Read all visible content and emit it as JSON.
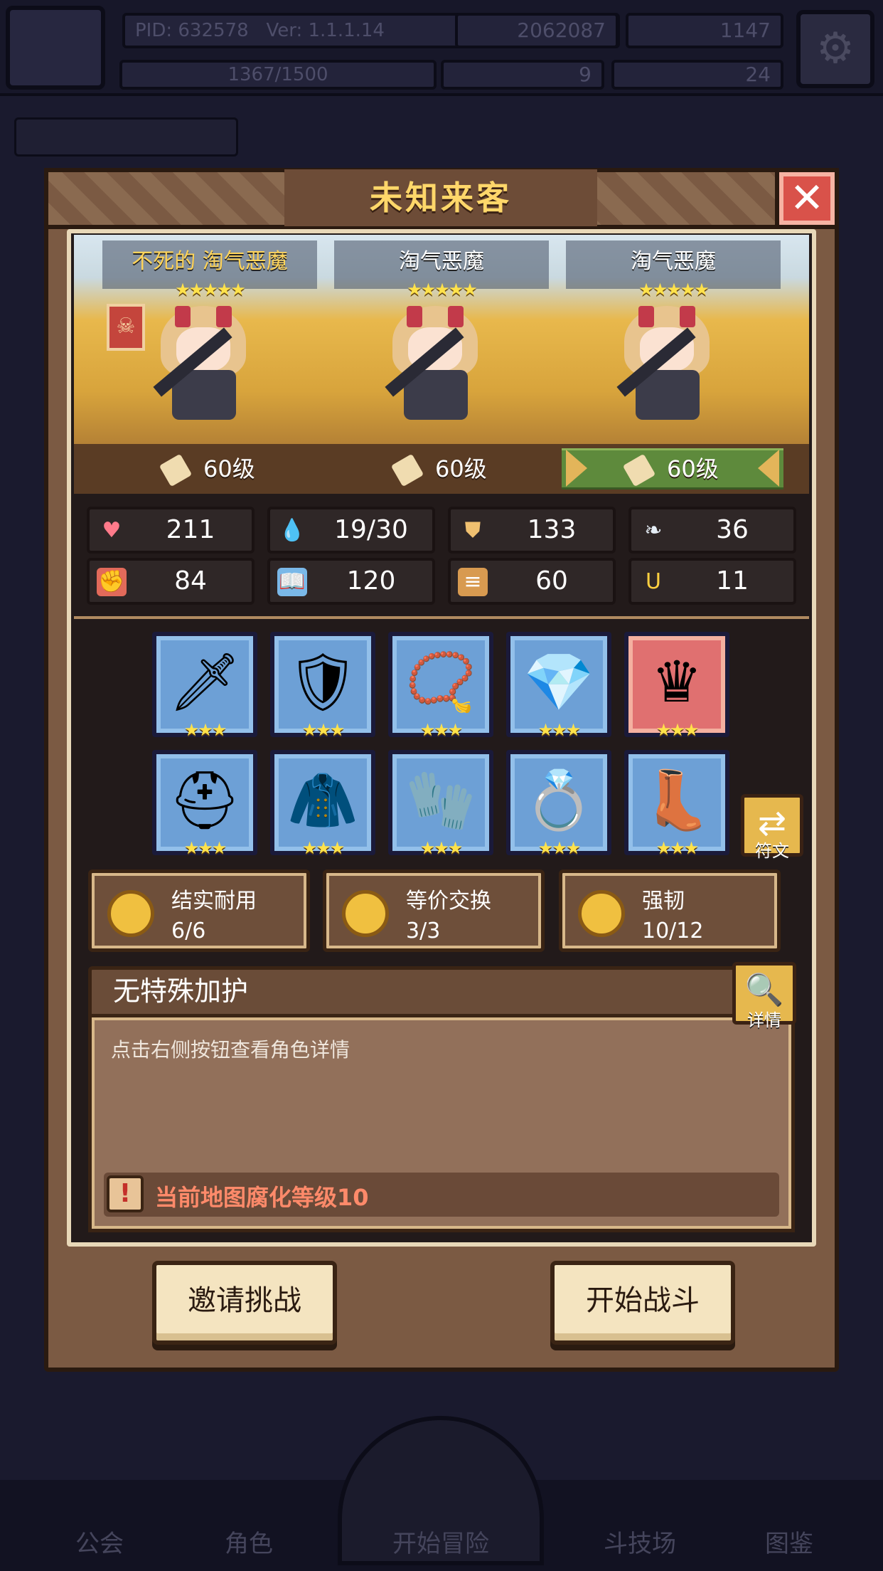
{
  "background": {
    "pid": "PID: 632578",
    "version": "Ver: 1.1.1.14",
    "currency_1": "2062087",
    "currency_2": "1147",
    "exp": "1367/1500",
    "currency_3": "9",
    "currency_4": "24",
    "nav": [
      "公会",
      "角色",
      "开始冒险",
      "斗技场",
      "图鉴"
    ]
  },
  "dialog": {
    "title": "未知来客",
    "close_icon": "close-icon",
    "enemies": [
      {
        "name": "不死的 淘气恶魔",
        "stars": "★★★★★",
        "level": "60级",
        "name_color": "#ffd45a"
      },
      {
        "name": "淘气恶魔",
        "stars": "★★★★★",
        "level": "60级"
      },
      {
        "name": "淘气恶魔",
        "stars": "★★★★★",
        "level": "60级",
        "selected": true
      }
    ],
    "stats": [
      {
        "icon": "heart-icon",
        "value": "211",
        "color": "#ff7a8a"
      },
      {
        "icon": "water-drop-icon",
        "value": "19/30",
        "color": "#6ac8f0"
      },
      {
        "icon": "shield-icon",
        "value": "133",
        "color": "#f0c070"
      },
      {
        "icon": "wing-icon",
        "value": "36",
        "color": "#e6eef6"
      },
      {
        "icon": "fist-icon",
        "value": "84",
        "color": "#e26a5a"
      },
      {
        "icon": "book-icon",
        "value": "120",
        "color": "#7ab8e8"
      },
      {
        "icon": "scroll-icon",
        "value": "60",
        "color": "#d89a50"
      },
      {
        "icon": "horseshoe-icon",
        "value": "11",
        "color": "#ffd040"
      }
    ],
    "equipment": [
      {
        "icon": "sword-icon",
        "stars": "★★★"
      },
      {
        "icon": "shield-icon",
        "stars": "★★★"
      },
      {
        "icon": "necklace-icon",
        "stars": "★★★"
      },
      {
        "icon": "gem-icon",
        "stars": "★★★"
      },
      {
        "icon": "crown-icon",
        "stars": "★★★",
        "rarity": "red"
      },
      {
        "icon": "hood-icon",
        "stars": "★★★"
      },
      {
        "icon": "armor-icon",
        "stars": "★★★"
      },
      {
        "icon": "gauntlet-icon",
        "stars": "★★★"
      },
      {
        "icon": "ring-icon",
        "stars": "★★★"
      },
      {
        "icon": "boots-icon",
        "stars": "★★★"
      }
    ],
    "rune_label": "符文",
    "traits": [
      {
        "name": "结实耐用",
        "count": "6/6"
      },
      {
        "name": "等价交换",
        "count": "3/3"
      },
      {
        "name": "强韧",
        "count": "10/12"
      }
    ],
    "blessing_title": "无特殊加护",
    "detail_label": "详情",
    "description": "点击右侧按钮查看角色详情",
    "warning": "当前地图腐化等级10",
    "buttons": {
      "invite": "邀请挑战",
      "start": "开始战斗"
    }
  }
}
